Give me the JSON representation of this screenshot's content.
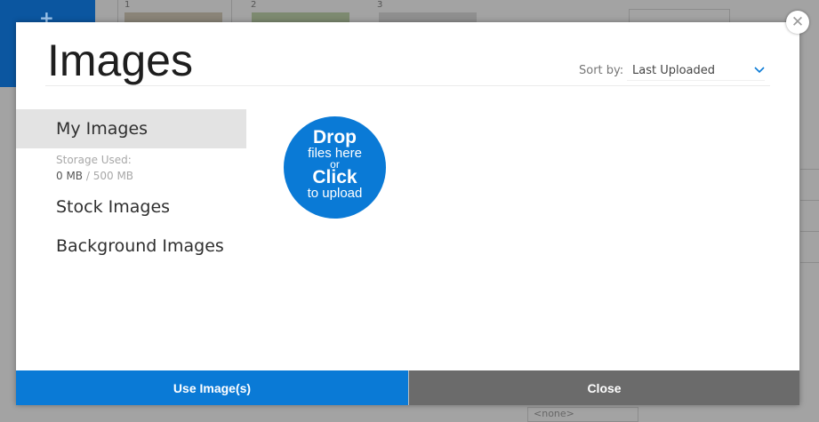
{
  "background": {
    "plus": "+",
    "numbers": [
      "1",
      "2",
      "3"
    ],
    "bottom_select": "<none>"
  },
  "modal": {
    "title": "Images",
    "close_glyph": "✕",
    "sort": {
      "label": "Sort by:",
      "value": "Last Uploaded"
    },
    "sidebar": {
      "my_images": "My Images",
      "storage_label": "Storage Used:",
      "storage_used": "0 MB",
      "storage_sep": " / ",
      "storage_total": "500 MB",
      "stock_images": "Stock Images",
      "background_images": "Background Images"
    },
    "dropzone": {
      "line1": "Drop",
      "line2": "files here",
      "line3": "or",
      "line4": "Click",
      "line5": "to upload"
    },
    "footer": {
      "use_label": "Use Image(s)",
      "close_label": "Close"
    }
  },
  "colors": {
    "accent": "#0a7ad6",
    "close_button": "#6b6b6b",
    "active_item": "#e3e3e3"
  }
}
